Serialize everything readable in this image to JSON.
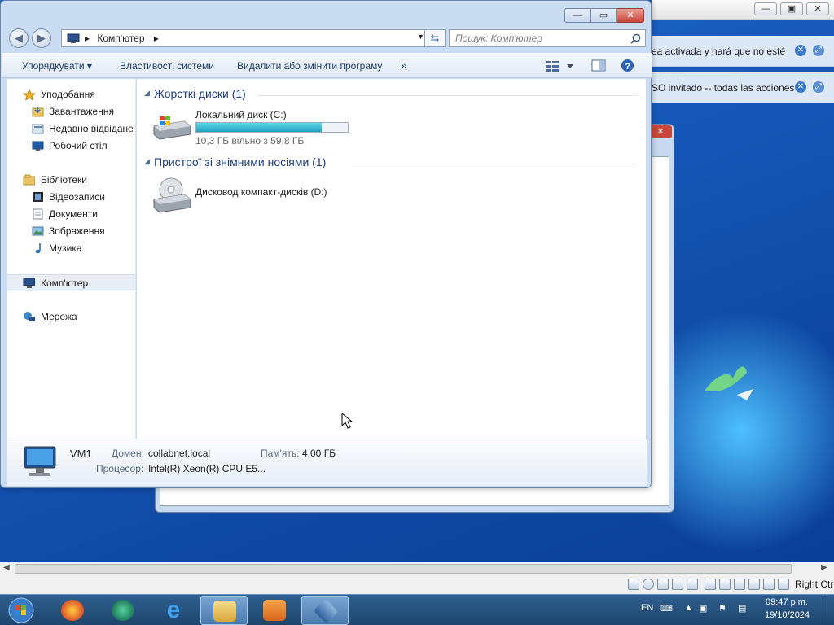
{
  "host": {
    "status_text": "Right Ctrl",
    "controls": {
      "minimize": "—",
      "restore": "▣",
      "close": "✕"
    }
  },
  "notifications": [
    {
      "text": "ea activada y hará que no esté"
    },
    {
      "text": "SO invitado -- todas las acciones"
    }
  ],
  "explorer": {
    "window_controls": {
      "minimize": "—",
      "maximize": "▭",
      "close": "✕"
    },
    "breadcrumb": {
      "location": "Комп'ютер",
      "arrow": "▸"
    },
    "search_placeholder": "Пошук: Комп'ютер",
    "toolbar": {
      "organize": "Упорядкувати ▾",
      "system_props": "Властивості системи",
      "uninstall": "Видалити або змінити програму",
      "more": "»"
    },
    "nav": {
      "favorites": "Уподобання",
      "downloads": "Завантаження",
      "recent": "Недавно відвідане",
      "desktop": "Робочий стіл",
      "libraries": "Бібліотеки",
      "videos": "Відеозаписи",
      "documents": "Документи",
      "pictures": "Зображення",
      "music": "Музика",
      "computer": "Комп'ютер",
      "network": "Мережа"
    },
    "groups": {
      "hard_drives": "Жорсткі диски (1)",
      "removable": "Пристрої зі знімними носіями (1)"
    },
    "drive_c": {
      "name": "Локальний диск (C:)",
      "space": "10,3 ГБ вільно з 59,8 ГБ",
      "used_fraction": 0.83
    },
    "drive_d": {
      "name": "Дисковод компакт-дисків (D:)"
    },
    "details": {
      "name": "VM1",
      "domain_label": "Домен:",
      "domain_value": "collabnet.local",
      "memory_label": "Пам'ять:",
      "memory_value": "4,00 ГБ",
      "cpu_label": "Процесор:",
      "cpu_value": "Intel(R) Xeon(R) CPU E5..."
    }
  },
  "taskbar": {
    "lang": "EN",
    "time": "09:47 p.m.",
    "date": "19/10/2024"
  }
}
